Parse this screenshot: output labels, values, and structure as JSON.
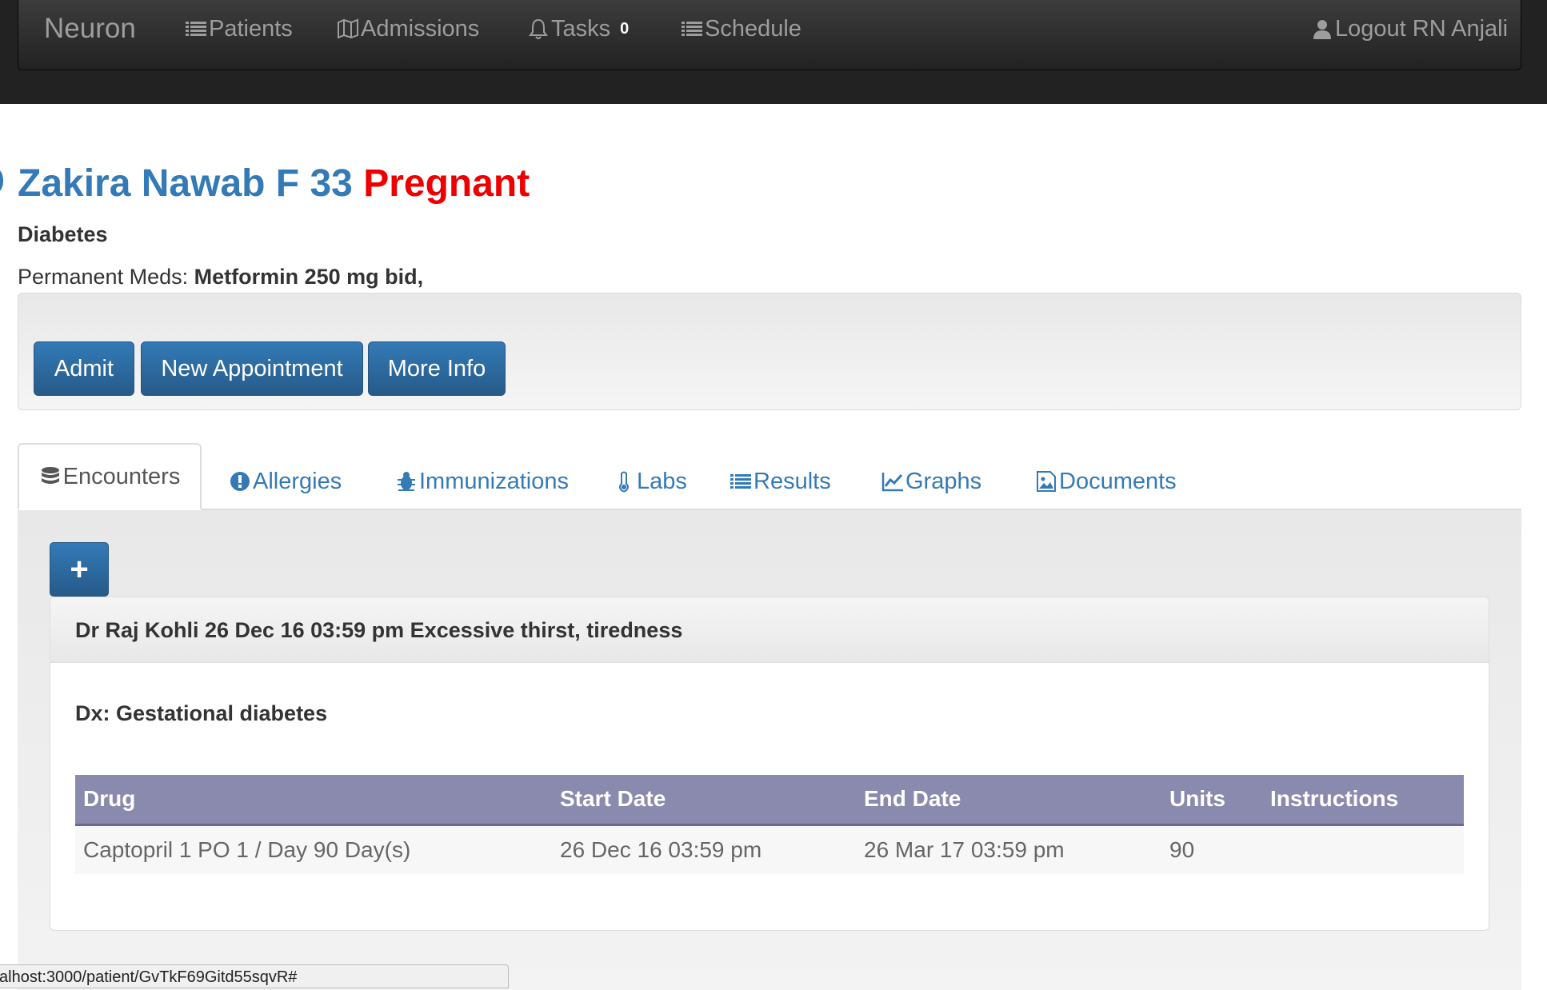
{
  "navbar": {
    "brand": "Neuron",
    "items": [
      {
        "label": "Patients",
        "icon": "list-icon"
      },
      {
        "label": "Admissions",
        "icon": "map-icon"
      },
      {
        "label": "Tasks",
        "icon": "bell-icon",
        "badge": "0"
      },
      {
        "label": "Schedule",
        "icon": "list-icon"
      }
    ],
    "logout": {
      "label": "Logout RN Anjali",
      "icon": "user-icon"
    }
  },
  "patient": {
    "name_line": "Zakira Nawab F 33",
    "flag": "Pregnant",
    "condition": "Diabetes",
    "meds_label": "Permanent Meds:",
    "meds_value": "Metformin 250 mg bid,"
  },
  "actions": {
    "admit": "Admit",
    "new_appointment": "New Appointment",
    "more_info": "More Info"
  },
  "tabs": [
    {
      "label": "Encounters",
      "icon": "database-icon",
      "active": true
    },
    {
      "label": "Allergies",
      "icon": "exclamation-icon"
    },
    {
      "label": "Immunizations",
      "icon": "bug-icon"
    },
    {
      "label": "Labs",
      "icon": "thermometer-icon"
    },
    {
      "label": "Results",
      "icon": "list-icon"
    },
    {
      "label": "Graphs",
      "icon": "line-chart-icon"
    },
    {
      "label": "Documents",
      "icon": "image-icon"
    }
  ],
  "encounter": {
    "add_label": "+",
    "heading": "Dr Raj Kohli 26 Dec 16 03:59 pm Excessive thirst, tiredness",
    "dx": "Dx: Gestational diabetes",
    "table": {
      "headers": [
        "Drug",
        "Start Date",
        "End Date",
        "Units",
        "Instructions"
      ],
      "rows": [
        [
          "Captopril 1 PO 1 / Day 90 Day(s)",
          "26 Dec 16 03:59 pm",
          "26 Mar 17 03:59 pm",
          "90",
          ""
        ]
      ]
    }
  },
  "status_bar": {
    "url": "alhost:3000/patient/GvTkF69Gitd55sqvR#"
  },
  "colors": {
    "primary": "#337ab7",
    "flag": "#ee0000",
    "navbar": "#222222",
    "table_header": "#8a8aae"
  }
}
